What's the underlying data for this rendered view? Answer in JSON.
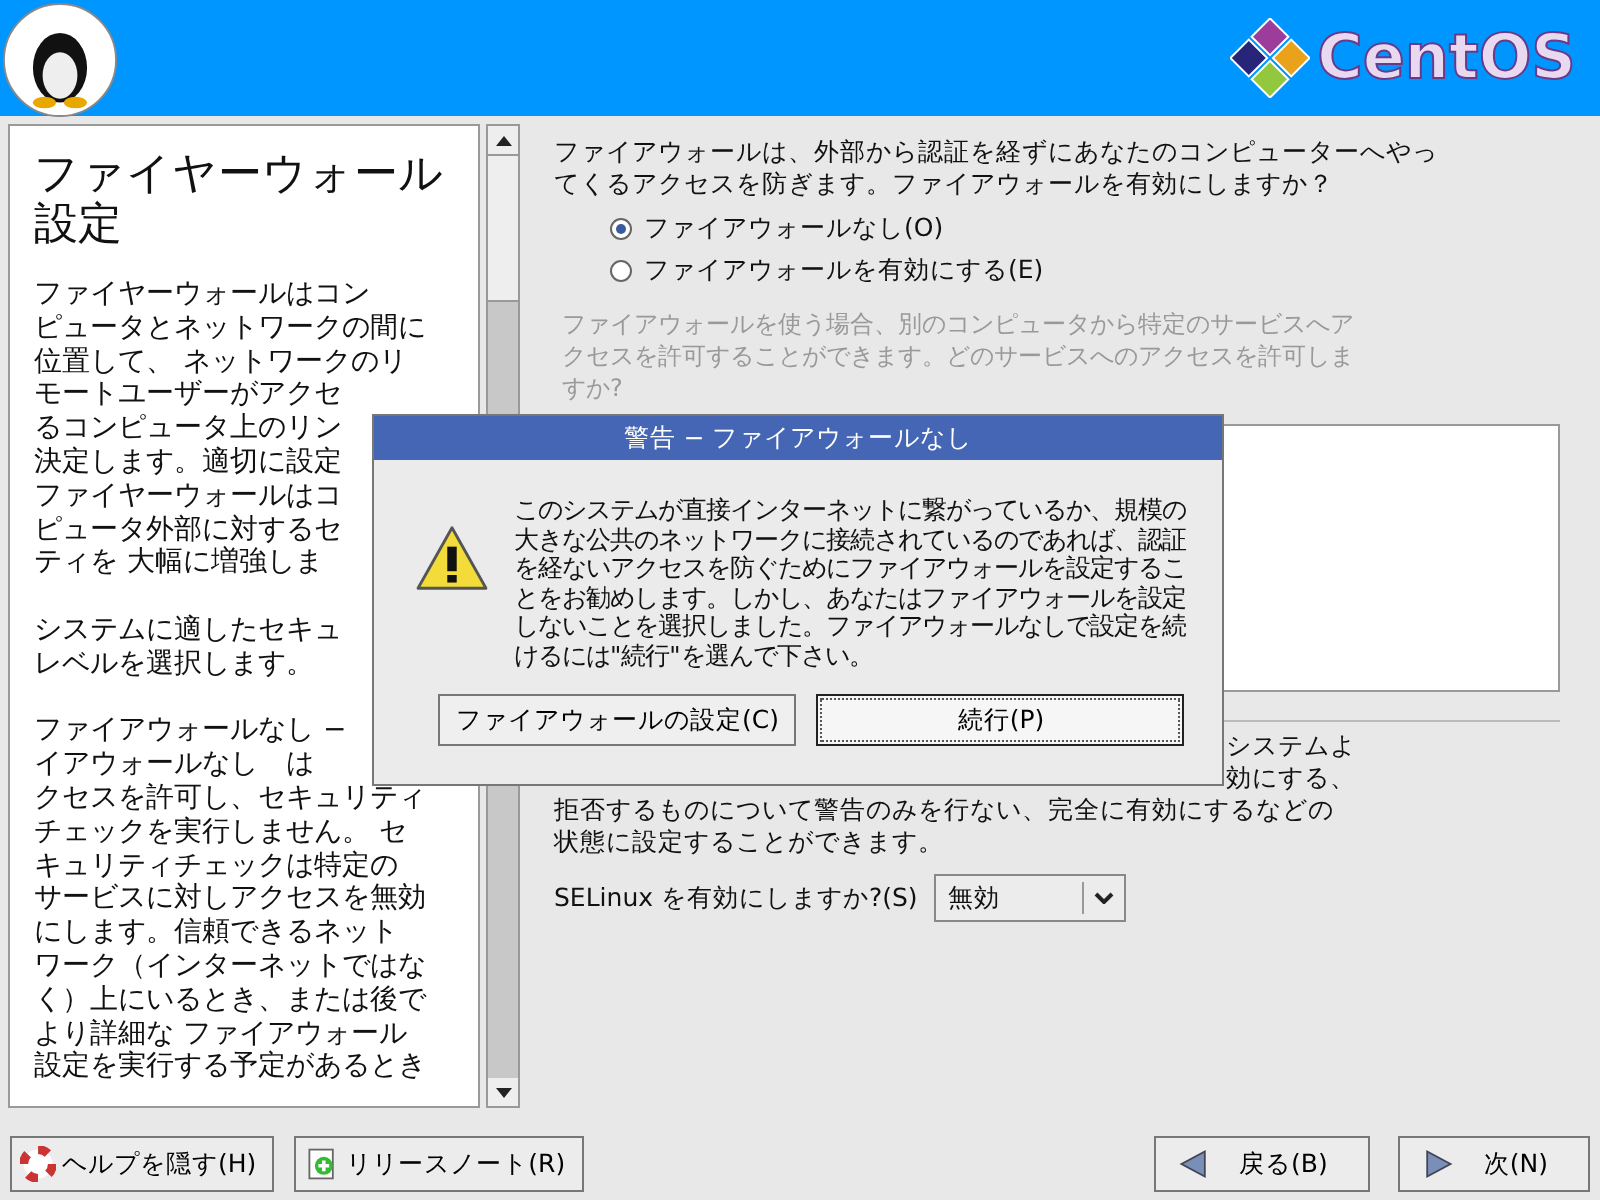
{
  "header": {
    "brand": "CentOS"
  },
  "help": {
    "title": "ファイヤーウォール設定",
    "paragraphs": [
      [
        "ファイヤーウォールはコン",
        "ピュータとネットワークの間に",
        "位置して、 ネットワークのリ",
        "モートユーザーがアクセ",
        "るコンピュータ上のリン",
        "決定します。適切に設定",
        "ファイヤーウォールはコ",
        "ピュータ外部に対するセ",
        "ティを 大幅に増強しま"
      ],
      [
        "システムに適したセキュ",
        "レベルを選択します。"
      ],
      [
        "ファイアウォールなし −",
        "イアウォールなし　は",
        "クセスを許可し、セキュリティ",
        "チェックを実行しません。 セ",
        "キュリティチェックは特定の",
        "サービスに対しアクセスを無効",
        "にします。信頼できるネット",
        "ワーク（インターネットではな",
        "く）上にいるとき、または後で",
        "より詳細な ファイアウォール",
        "設定を実行する予定があるとき"
      ]
    ]
  },
  "firewall": {
    "question": "ファイアウォールは、外部から認証を経ずにあなたのコンピューターへやってくるアクセスを防ぎます。ファイアウォールを有効にしますか？",
    "options": [
      {
        "label": "ファイアウォールなし(O)",
        "selected": true
      },
      {
        "label": "ファイアウォールを有効にする(E)",
        "selected": false
      }
    ],
    "services_hint": "ファイアウォールを使う場合、別のコンピュータから特定のサービスへアクセスを許可することができます。どのサービスへのアクセスを許可しますか?"
  },
  "selinux": {
    "partial_lines": [
      "システムよ",
      "効にする、"
    ],
    "lines": [
      "拒否するものについて警告のみを行ない、完全に有効にするなどの",
      "状態に設定することができます。"
    ],
    "label": "SELinux を有効にしますか?(S)",
    "value": "無効"
  },
  "dialog": {
    "title": "警告 − ファイアウォールなし",
    "message": "このシステムが直接インターネットに繋がっているか、規模の大きな公共のネットワークに接続されているのであれば、認証を経ないアクセスを防ぐためにファイアウォールを設定することをお勧めします。しかし、あなたはファイアウォールを設定しないことを選択しました。ファイアウォールなしで設定を続けるには\"続行\"を選んで下さい。",
    "buttons": [
      {
        "label": "ファイアウォールの設定(C)",
        "selected": false
      },
      {
        "label": "続行(P)",
        "selected": true
      }
    ]
  },
  "footer": {
    "help_button": "ヘルプを隠す(H)",
    "notes_button": "リリースノート(R)",
    "back_button": "戻る(B)",
    "next_button": "次(N)"
  }
}
